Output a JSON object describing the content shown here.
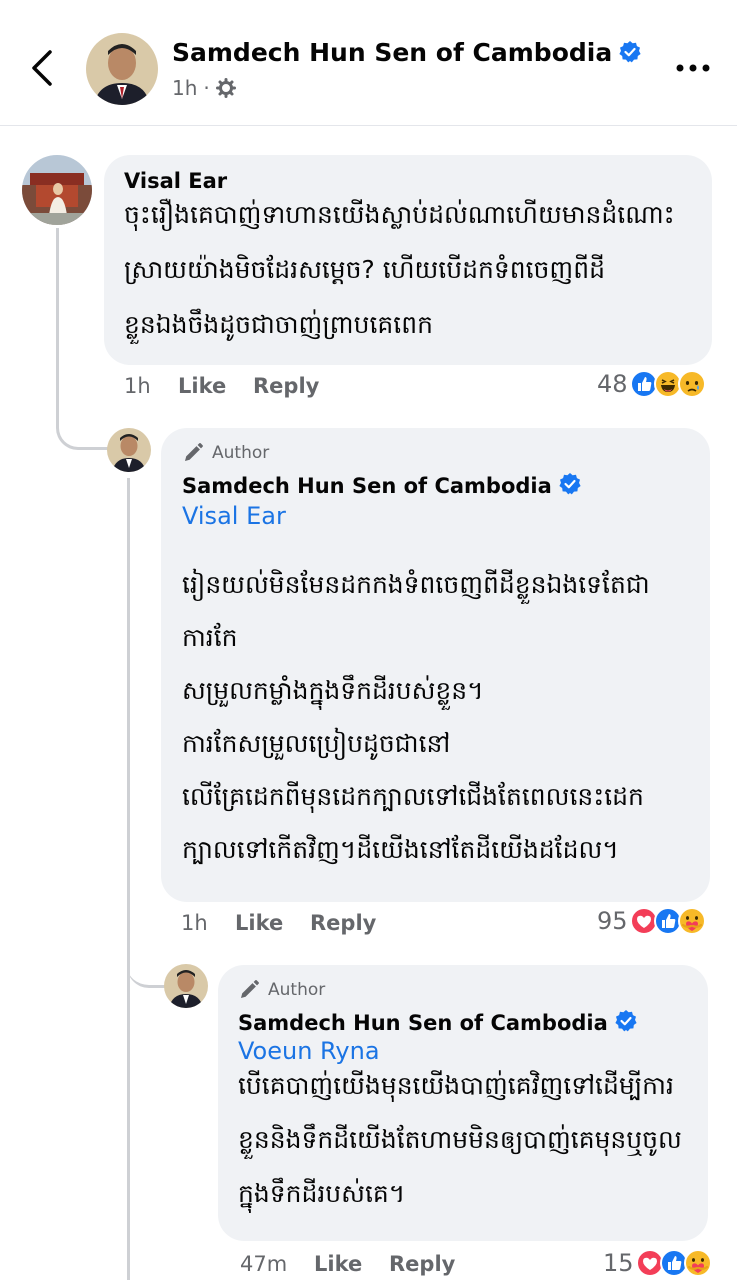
{
  "header": {
    "page_name": "Samdech Hun Sen of Cambodia",
    "time": "1h",
    "separator": "·"
  },
  "actions": {
    "like": "Like",
    "reply": "Reply"
  },
  "comments": [
    {
      "author": "Visal Ear",
      "text": "ចុះរឿងគេបាញ់ទាហានយើងស្លាប់ដល់ណាហើយមានដំណោះស្រាយយ៉ាងមិចដែរសម្ដេច? ហើយបើដកទំពចេញពីដីខ្លួនឯងចឹងដូចជាចាញ់ព្រាបគេពេក",
      "time": "1h",
      "reaction_count": "48"
    },
    {
      "badge": "Author",
      "author": "Samdech Hun Sen of Cambodia",
      "mention": "Visal Ear",
      "lines": [
        "រៀនយល់មិនមែនដកកងទំពចេញពីដីខ្លួនឯងទេតែជា",
        "ការកែ",
        "សម្រួលកម្លាំងក្នុងទឹកដីរបស់ខ្លួន។",
        "ការកែសម្រួលប្រៀបដូចជានៅ",
        "លើគ្រែដេកពីមុនដេកក្បាលទៅជើងតែពេលនេះដេក",
        "ក្បាលទៅកើតវិញ។ដីយើងនៅតែដីយើងដដែល។"
      ],
      "time": "1h",
      "reaction_count": "95"
    },
    {
      "badge": "Author",
      "author": "Samdech Hun Sen of Cambodia",
      "mention": "Voeun Ryna",
      "text": "បើគេបាញ់យើងមុនយើងបាញ់គេវិញទៅដើម្បីការខ្លួននិងទឹកដីយើងតែហាមមិនឲ្យបាញ់គេមុនឬចូលក្នុងទឹកដីរបស់គេ។",
      "time": "47m",
      "reaction_count": "15"
    }
  ],
  "colors": {
    "link": "#1b74e4",
    "verified": "#1877f2",
    "bubble": "#f0f2f5",
    "meta": "#65676b"
  },
  "icons": [
    "back-chevron-icon",
    "verified-badge-icon",
    "globe-gear-icon",
    "more-dots-icon",
    "pencil-icon",
    "like-reaction-icon",
    "haha-reaction-icon",
    "sad-reaction-icon",
    "love-reaction-icon",
    "care-reaction-icon"
  ]
}
